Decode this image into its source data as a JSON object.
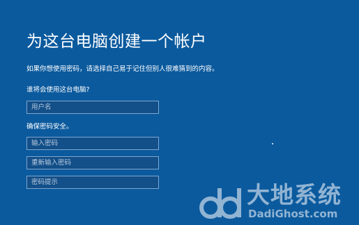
{
  "page": {
    "title": "为这台电脑创建一个帐户",
    "description": "如果你想使用密码，请选择自己易于记住但别人很难猜到的内容。"
  },
  "who_section": {
    "label": "谁将会使用这台电脑?",
    "username_placeholder": "用户名",
    "username_value": ""
  },
  "security_section": {
    "label": "确保密码安全。",
    "password_placeholder": "输入密码",
    "reenter_placeholder": "重新输入密码",
    "hint_placeholder": "密码提示"
  },
  "watermark": {
    "text_cn": "大地系统",
    "text_en": "DadiGhost.com"
  },
  "colors": {
    "background": "#0b5a9e",
    "field_background": "#134f88",
    "field_border": "#7fa7cd"
  }
}
